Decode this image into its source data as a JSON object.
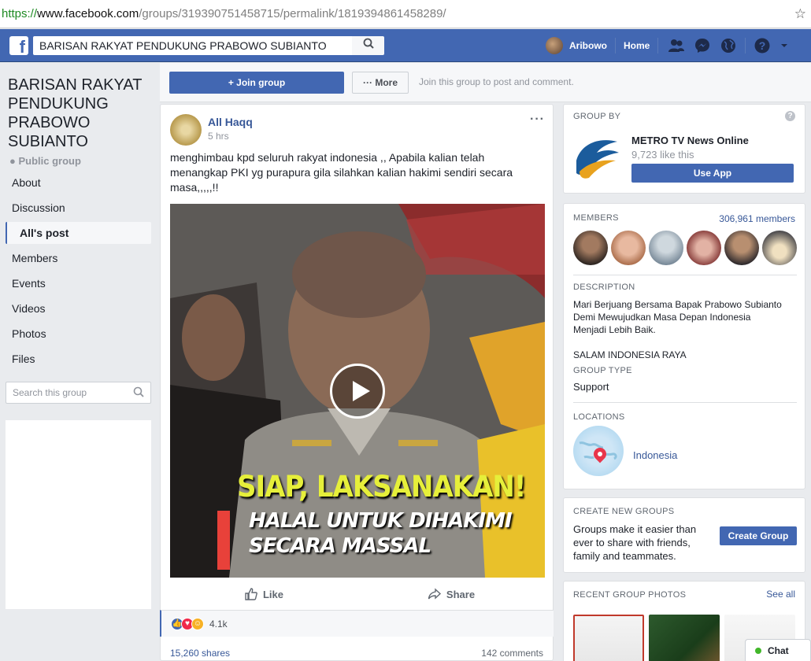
{
  "browser": {
    "url_scheme": "https://",
    "url_host": "www.facebook.com",
    "url_path": "/groups/319390751458715/permalink/1819394861458289/"
  },
  "topbar": {
    "logo": "f",
    "search_value": "BARISAN RAKYAT PENDUKUNG PRABOWO SUBIANTO",
    "profile_name": "Aribowo",
    "home_label": "Home",
    "brand_color": "#4267b2"
  },
  "group": {
    "title": "BARISAN RAKYAT PENDUKUNG PRABOWO SUBIANTO",
    "privacy": "Public group",
    "nav": [
      "About",
      "Discussion",
      "All's post",
      "Members",
      "Events",
      "Videos",
      "Photos",
      "Files"
    ],
    "active_nav": "All's post",
    "search_placeholder": "Search this group"
  },
  "joinbar": {
    "join_label": "+ Join group",
    "more_label": "··· More",
    "hint": "Join this group to post and comment."
  },
  "post": {
    "author": "All Haqq",
    "time": "5 hrs",
    "text": "menghimbau kpd seluruh rakyat indonesia ,, Apabila kalian telah menangkap PKI yg purapura gila silahkan kalian hakimi sendiri secara masa,,,,,!!",
    "video_caption_1": "SIAP, LAKSANAKAN!",
    "video_caption_2": "HALAL UNTUK DIHAKIMI",
    "video_caption_3": "SECARA MASSAL",
    "like_label": "Like",
    "share_label": "Share",
    "reactions_count": "4.1k",
    "shares": "15,260 shares",
    "comments": "142 comments"
  },
  "sidebar": {
    "group_by_heading": "GROUP BY",
    "page_name": "METRO TV News Online",
    "page_likes": "9,723 like this",
    "use_app": "Use App",
    "members_heading": "MEMBERS",
    "members_count": "306,961 members",
    "description_heading": "DESCRIPTION",
    "description": "Mari Berjuang Bersama Bapak Prabowo Subianto Demi Mewujudkan Masa Depan Indonesia Menjadi Lebih Baik.",
    "description_2": "SALAM INDONESIA RAYA",
    "group_type_heading": "GROUP TYPE",
    "group_type": "Support",
    "locations_heading": "LOCATIONS",
    "location": "Indonesia",
    "create_heading": "CREATE NEW GROUPS",
    "create_text": "Groups make it easier than ever to share with friends, family and teammates.",
    "create_button": "Create Group",
    "photos_heading": "RECENT GROUP PHOTOS",
    "see_all": "See all"
  },
  "chat": {
    "label": "Chat"
  }
}
